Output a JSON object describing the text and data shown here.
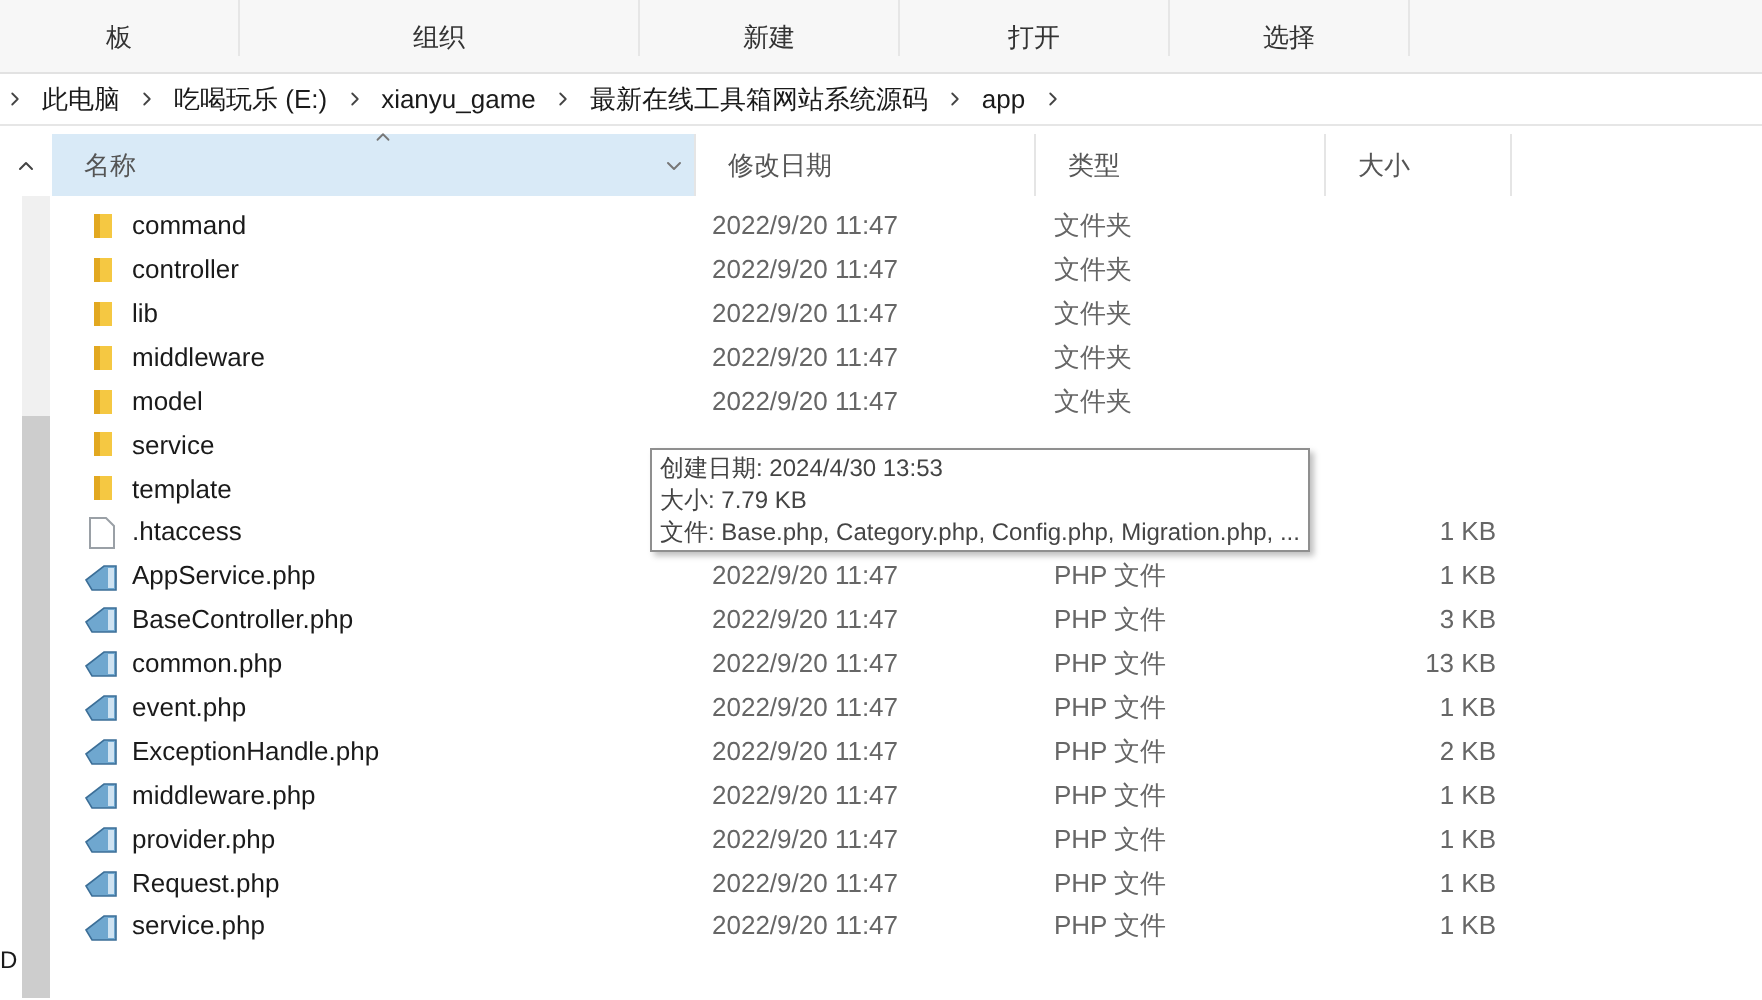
{
  "ribbon": {
    "groups": [
      "板",
      "组织",
      "新建",
      "打开",
      "选择"
    ]
  },
  "breadcrumb": [
    "此电脑",
    "吃喝玩乐 (E:)",
    "xianyu_game",
    "最新在线工具箱网站系统源码",
    "app"
  ],
  "nav_pane": {
    "items": [
      "D"
    ]
  },
  "columns": [
    {
      "label": "名称",
      "selected": true
    },
    {
      "label": "修改日期",
      "selected": false
    },
    {
      "label": "类型",
      "selected": false
    },
    {
      "label": "大小",
      "selected": false
    }
  ],
  "rows": [
    {
      "kind": "folder",
      "name": "command",
      "date": "2022/9/20 11:47",
      "type": "文件夹"
    },
    {
      "kind": "folder",
      "name": "controller",
      "date": "2022/9/20 11:47",
      "type": "文件夹"
    },
    {
      "kind": "folder",
      "name": "lib",
      "date": "2022/9/20 11:47",
      "type": "文件夹"
    },
    {
      "kind": "folder",
      "name": "middleware",
      "date": "2022/9/20 11:47",
      "type": "文件夹"
    },
    {
      "kind": "folder",
      "name": "model",
      "date": "2022/9/20 11:47",
      "type": "文件夹"
    },
    {
      "kind": "folder",
      "name": "service"
    },
    {
      "kind": "folder",
      "name": "template"
    },
    {
      "kind": "file",
      "name": ".htaccess",
      "size": "1 KB"
    },
    {
      "kind": "php",
      "name": "AppService.php",
      "date": "2022/9/20 11:47",
      "type": "PHP 文件",
      "size": "1 KB"
    },
    {
      "kind": "php",
      "name": "BaseController.php",
      "date": "2022/9/20 11:47",
      "type": "PHP 文件",
      "size": "3 KB"
    },
    {
      "kind": "php",
      "name": "common.php",
      "date": "2022/9/20 11:47",
      "type": "PHP 文件",
      "size": "13 KB"
    },
    {
      "kind": "php",
      "name": "event.php",
      "date": "2022/9/20 11:47",
      "type": "PHP 文件",
      "size": "1 KB"
    },
    {
      "kind": "php",
      "name": "ExceptionHandle.php",
      "date": "2022/9/20 11:47",
      "type": "PHP 文件",
      "size": "2 KB"
    },
    {
      "kind": "php",
      "name": "middleware.php",
      "date": "2022/9/20 11:47",
      "type": "PHP 文件",
      "size": "1 KB"
    },
    {
      "kind": "php",
      "name": "provider.php",
      "date": "2022/9/20 11:47",
      "type": "PHP 文件",
      "size": "1 KB"
    },
    {
      "kind": "php",
      "name": "Request.php",
      "date": "2022/9/20 11:47",
      "type": "PHP 文件",
      "size": "1 KB"
    },
    {
      "kind": "php",
      "name": "service.php",
      "date": "2022/9/20 11:47",
      "type": "PHP 文件",
      "size": "1 KB"
    }
  ],
  "tooltip": {
    "lines": [
      "创建日期: 2024/4/30 13:53",
      "大小: 7.79 KB",
      "文件: Base.php, Category.php, Config.php, Migration.php, ..."
    ]
  }
}
